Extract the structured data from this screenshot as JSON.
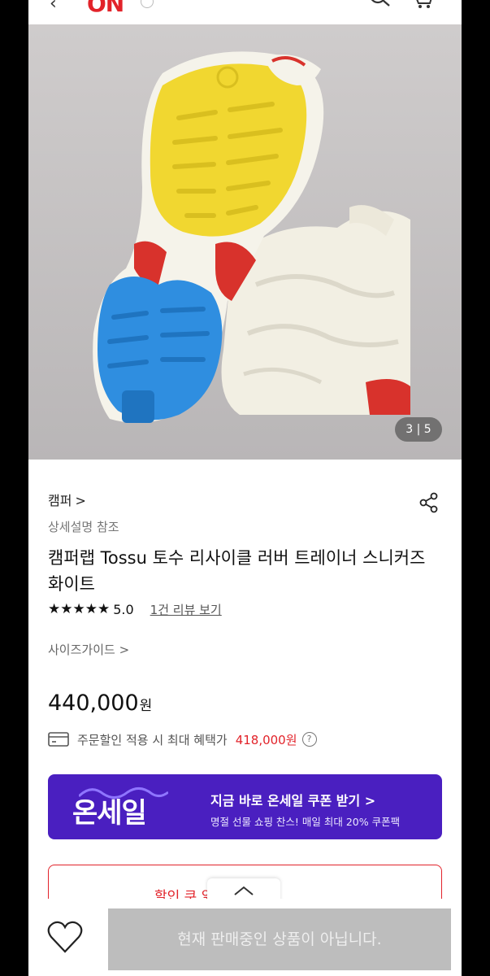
{
  "header": {
    "back_icon": "chevron-left-icon",
    "logo_text": "ON",
    "search_icon": "search-icon",
    "cart_icon": "cart-icon"
  },
  "gallery": {
    "counter": "3 | 5",
    "colors": {
      "yellow": "#f1d730",
      "blue": "#2f8ee0",
      "red": "#d8322c",
      "cream": "#f2efe3"
    }
  },
  "product": {
    "brand": "캠퍼",
    "brand_chevron": ">",
    "detail_ref": "상세설명 참조",
    "title": "캠퍼랩 Tossu 토수 리사이클 러버 트레이너 스니커즈 화이트",
    "stars": "★★★★★",
    "score": "5.0",
    "review_link": "1건 리뷰 보기",
    "size_guide": "사이즈가이드 >",
    "price": "440,000",
    "price_unit": "원",
    "benefit_label": "주문할인 적용 시 최대 혜택가",
    "benefit_price": "418,000원",
    "help_mark": "?"
  },
  "banner": {
    "logo": "온세일",
    "title": "지금 바로 온세일 쿠폰 받기 >",
    "subtitle": "명절 선물 쇼핑 찬스! 매일 최대 20% 쿠폰팩",
    "color": "#4a1fc0"
  },
  "coupon": {
    "label": "할인 쿠             읽 ↓"
  },
  "bottom": {
    "wishlist_icon": "heart-icon",
    "sold_out": "현재 판매중인 상품이 아닙니다."
  },
  "accent": "#e2232a"
}
